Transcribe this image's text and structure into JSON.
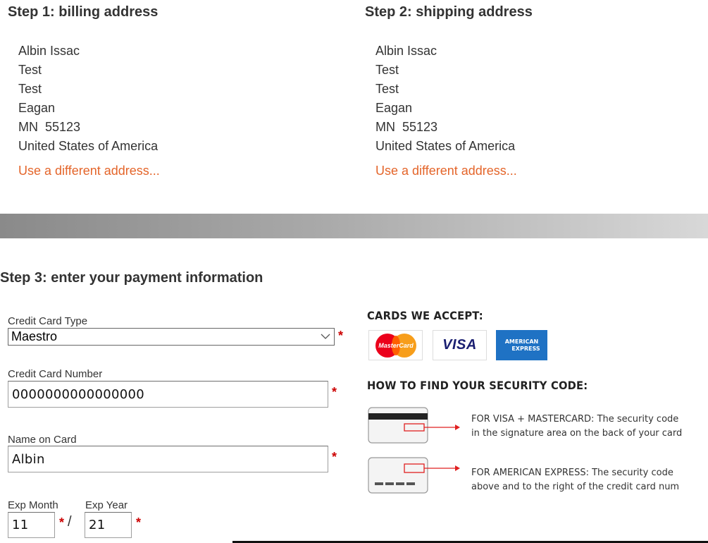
{
  "billing": {
    "heading": "Step 1: billing address",
    "lines": [
      "Albin Issac",
      "Test",
      "Test",
      "Eagan",
      "MN  55123",
      "United States of America"
    ],
    "link": "Use a different address..."
  },
  "shipping": {
    "heading": "Step 2: shipping address",
    "lines": [
      "Albin Issac",
      "Test",
      "Test",
      "Eagan",
      "MN  55123",
      "United States of America"
    ],
    "link": "Use a different address..."
  },
  "payment": {
    "heading": "Step 3: enter your payment information",
    "card_type_label": "Credit Card Type",
    "card_type_value": "Maestro",
    "card_number_label": "Credit Card Number",
    "card_number_value": "0000000000000000",
    "name_label": "Name on Card",
    "name_value": "Albin",
    "exp_month_label": "Exp Month",
    "exp_month_value": "11",
    "exp_year_label": "Exp Year",
    "exp_year_value": "21",
    "required_mark": "*",
    "separator": "/"
  },
  "cards": {
    "heading": "CARDS WE ACCEPT:",
    "mastercard": "MasterCard",
    "visa": "VISA",
    "amex_line1": "AMERICAN",
    "amex_line2": "EXPRESS"
  },
  "security": {
    "heading": "HOW TO FIND YOUR SECURITY CODE:",
    "visa_mc_line1": "FOR VISA + MASTERCARD: The security code",
    "visa_mc_line2": "in the signature area on the back of your card",
    "amex_line1": "FOR AMERICAN EXPRESS: The security code",
    "amex_line2": "above and to the right of the credit card num"
  },
  "colors": {
    "link": "#e4652a",
    "required": "#cc0000",
    "amex_blue": "#1f72c4",
    "visa_blue": "#1a1f71",
    "mc_red": "#eb001b",
    "mc_orange": "#f79e1b"
  }
}
